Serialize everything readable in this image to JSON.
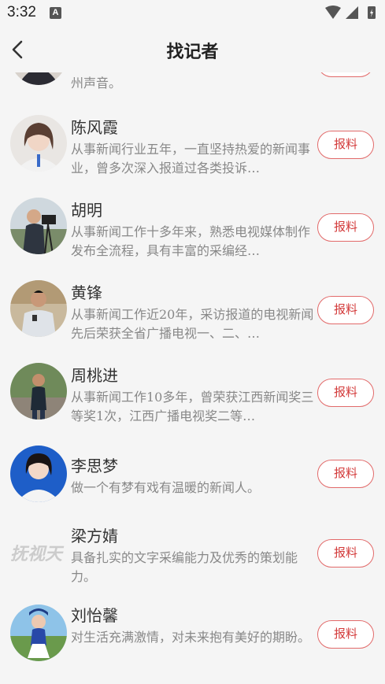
{
  "status_bar": {
    "time": "3:32",
    "notification_icon": "a-icon"
  },
  "header": {
    "title": "找记者",
    "back_icon": "back-arrow-icon"
  },
  "report_label": "报料",
  "reporters": [
    {
      "name": "",
      "desc": "州声音。"
    },
    {
      "name": "陈风霞",
      "desc": "从事新闻行业五年，一直坚持热爱的新闻事业，曾多次深入报道过各类投诉…"
    },
    {
      "name": "胡明",
      "desc": "从事新闻工作十多年来，熟悉电视媒体制作发布全流程，具有丰富的采编经…"
    },
    {
      "name": "黄锋",
      "desc": "从事新闻工作近20年，采访报道的电视新闻先后荣获全省广播电视一、二、…"
    },
    {
      "name": "周桃进",
      "desc": "从事新闻工作10多年，曾荣获江西新闻奖三等奖1次，江西广播电视奖二等…"
    },
    {
      "name": "李思梦",
      "desc": "做一个有梦有戏有温暖的新闻人。"
    },
    {
      "name": "梁方婧",
      "desc": "具备扎实的文字采编能力及优秀的策划能力。",
      "avatar_watermark": "抚视天"
    },
    {
      "name": "刘怡馨",
      "desc": "对生活充满激情，对未来抱有美好的期盼。"
    }
  ]
}
